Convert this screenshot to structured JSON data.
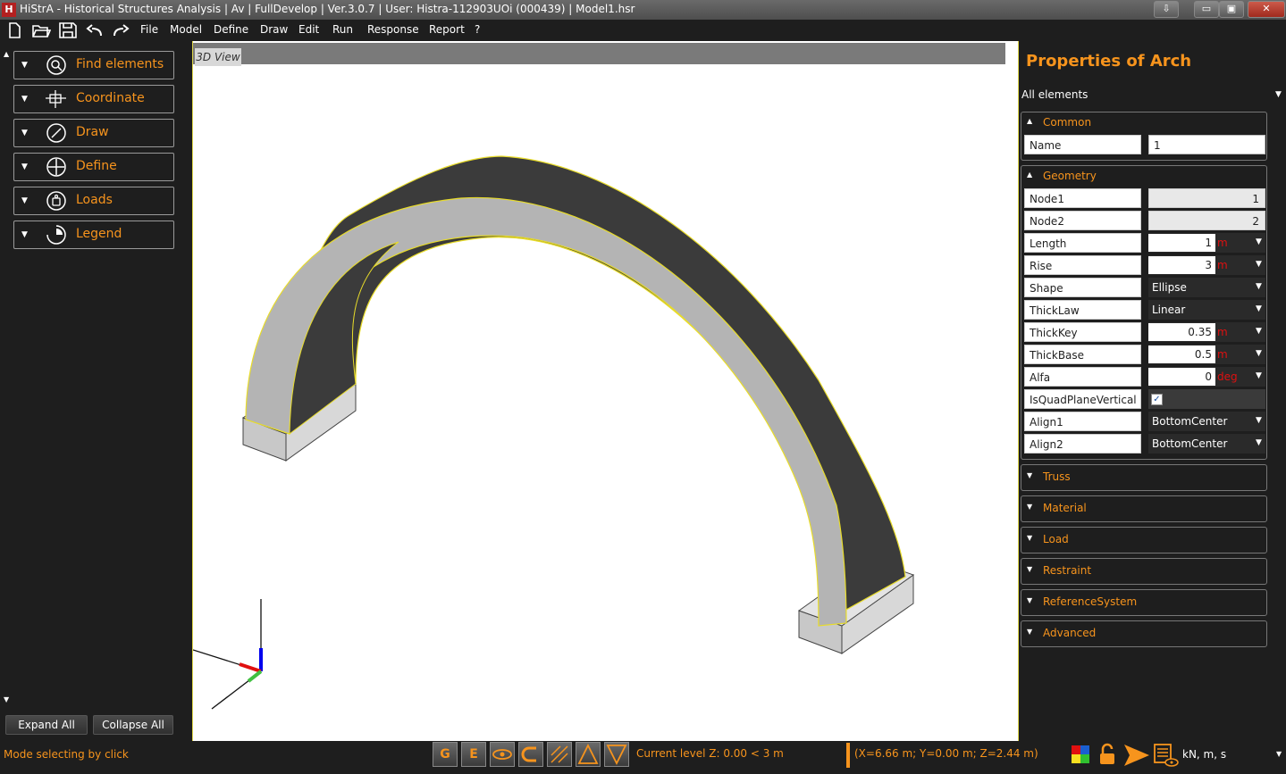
{
  "window": {
    "title": "HiStrA - Historical Structures Analysis | Av | FullDevelop | Ver.3.0.7 | User: Histra-112903UOi (000439) | Model1.hsr",
    "app_icon_text": "H",
    "min_label": "⇩",
    "restore_label": "▭",
    "max_label": "▣",
    "close_label": "✕"
  },
  "menu": [
    "File",
    "Model",
    "Define",
    "Draw",
    "Edit",
    "Run",
    "Response",
    "Report",
    "?"
  ],
  "left_panel": {
    "items": [
      "Find elements",
      "Coordinate",
      "Draw",
      "Define",
      "Loads",
      "Legend"
    ],
    "expand_all": "Expand All",
    "collapse_all": "Collapse All"
  },
  "viewport": {
    "tab_label": "3D View"
  },
  "properties": {
    "title": "Properties of Arch",
    "filter": "All elements",
    "common": {
      "label": "Common",
      "name_label": "Name",
      "name_value": "1"
    },
    "geometry": {
      "label": "Geometry",
      "node1": {
        "label": "Node1",
        "value": "1"
      },
      "node2": {
        "label": "Node2",
        "value": "2"
      },
      "length": {
        "label": "Length",
        "value": "1",
        "unit": "m"
      },
      "rise": {
        "label": "Rise",
        "value": "3",
        "unit": "m"
      },
      "shape": {
        "label": "Shape",
        "value": "Ellipse"
      },
      "thicklaw": {
        "label": "ThickLaw",
        "value": "Linear"
      },
      "thickkey": {
        "label": "ThickKey",
        "value": "0.35",
        "unit": "m"
      },
      "thickbase": {
        "label": "ThickBase",
        "value": "0.5",
        "unit": "m"
      },
      "alfa": {
        "label": "Alfa",
        "value": "0",
        "unit": "deg"
      },
      "isquad": {
        "label": "IsQuadPlaneVertical",
        "checked": true
      },
      "align1": {
        "label": "Align1",
        "value": "BottomCenter"
      },
      "align2": {
        "label": "Align2",
        "value": "BottomCenter"
      }
    },
    "sections": [
      "Truss",
      "Material",
      "Load",
      "Restraint",
      "ReferenceSystem",
      "Advanced"
    ]
  },
  "status": {
    "mode": "Mode selecting by click",
    "level": "Current level Z: 0.00 < 3 m",
    "coords": "(X=6.66 m; Y=0.00 m; Z=2.44 m)",
    "units": "kN, m, s",
    "btn_g": "G",
    "btn_e": "E"
  },
  "colors": {
    "accent": "#f7941d",
    "unit_red": "#e01010",
    "arch_dark": "#3b3b3b",
    "arch_light": "#b4b4b4"
  }
}
